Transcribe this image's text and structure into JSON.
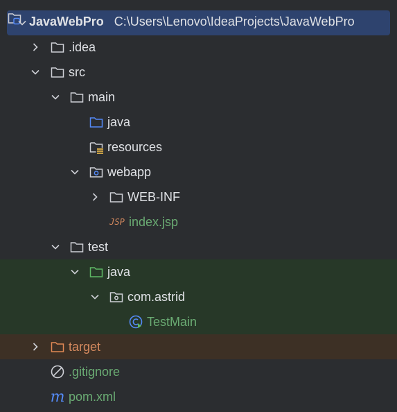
{
  "project": {
    "name": "JavaWebPro",
    "path": "C:\\Users\\Lenovo\\IdeaProjects\\JavaWebPro"
  },
  "nodes": {
    "idea": ".idea",
    "src": "src",
    "main": "main",
    "main_java": "java",
    "resources": "resources",
    "webapp": "webapp",
    "web_inf": "WEB-INF",
    "index_jsp": "index.jsp",
    "jsp_badge": "JSP",
    "test": "test",
    "test_java": "java",
    "com_astrid": "com.astrid",
    "test_main": "TestMain",
    "target": "target",
    "gitignore": ".gitignore",
    "pom": "pom.xml",
    "pom_badge": "m"
  },
  "colors": {
    "background": "#2b2d30",
    "selection": "#2e436e",
    "test_source_highlight": "#273828",
    "excluded_highlight": "#3d3025",
    "text": "#dfe1e5",
    "green_text": "#6aab73",
    "orange_text": "#d4895e",
    "source_folder_blue": "#548af7",
    "test_folder_green": "#5fb865",
    "excluded_folder_orange": "#e08855"
  }
}
